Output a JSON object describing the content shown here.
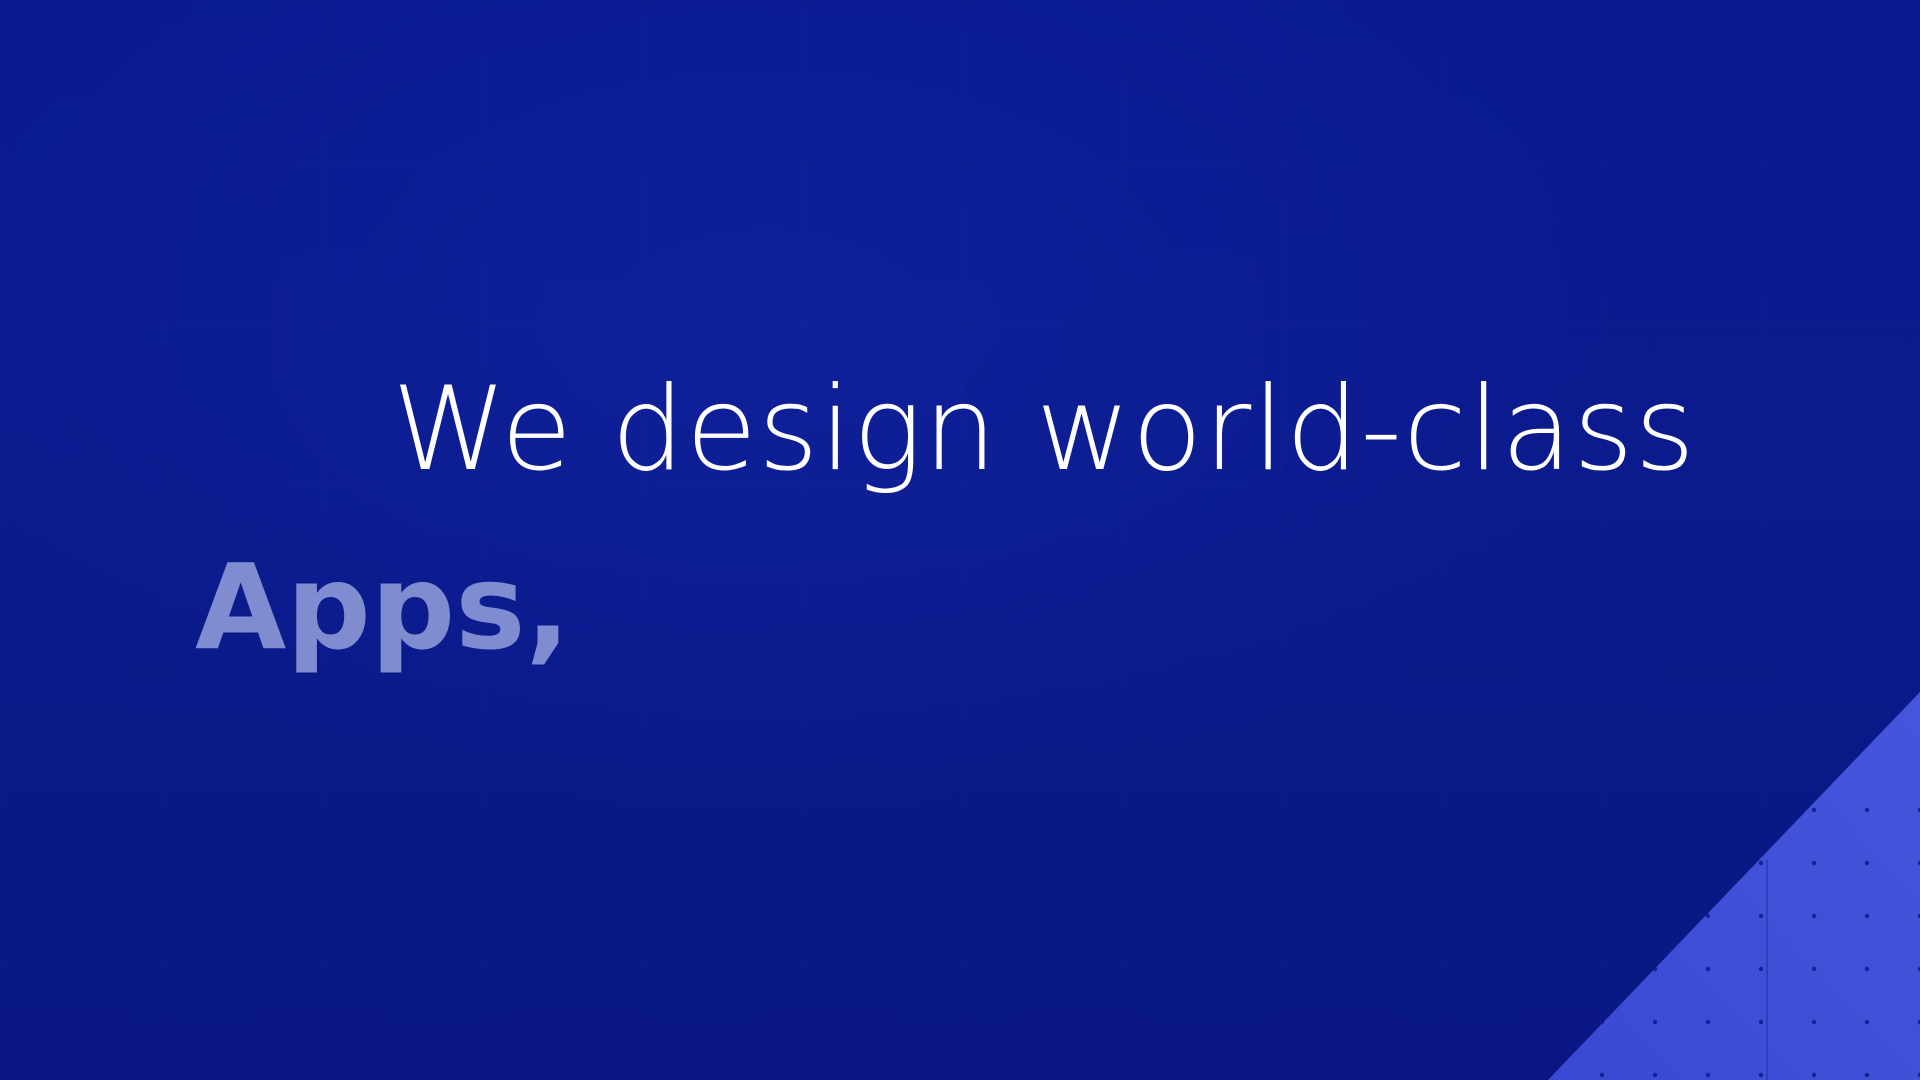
{
  "hero": {
    "headline": "We design world-class",
    "rotating_word": "Apps,"
  },
  "colors": {
    "background": "#0b1a8c",
    "headline_text": "#ffffff",
    "rotating_word_text": "#8a96d6",
    "accent_panel": "#3f4fd6",
    "accent_dots": "#0b1a8c"
  }
}
